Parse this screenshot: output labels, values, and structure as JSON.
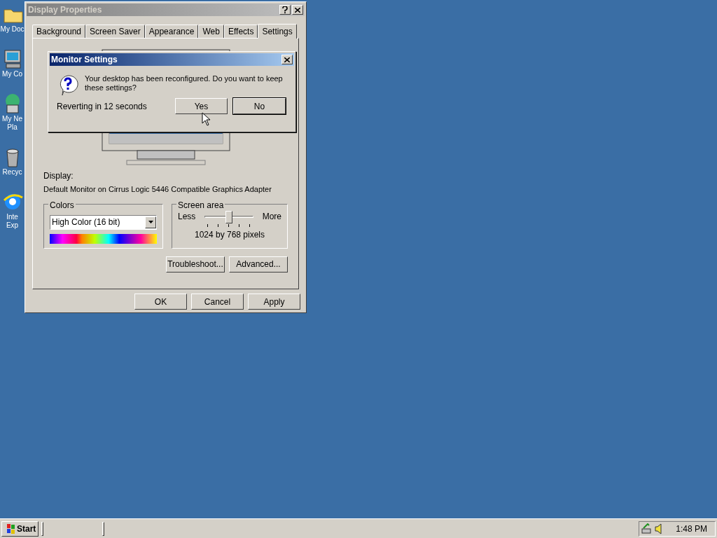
{
  "desktop_icons": [
    {
      "kind": "folder",
      "lines": [
        "My Doc"
      ]
    },
    {
      "kind": "computer",
      "lines": [
        "My Co"
      ]
    },
    {
      "kind": "network",
      "lines": [
        "My Ne",
        "Pla"
      ]
    },
    {
      "kind": "bin",
      "lines": [
        "Recyc"
      ]
    },
    {
      "kind": "browser",
      "lines": [
        "Inte",
        "Exp"
      ]
    }
  ],
  "window": {
    "title": "Display Properties",
    "active": false,
    "tabs": [
      {
        "label": "Background",
        "selected": false
      },
      {
        "label": "Screen Saver",
        "selected": false
      },
      {
        "label": "Appearance",
        "selected": false
      },
      {
        "label": "Web",
        "selected": false
      },
      {
        "label": "Effects",
        "selected": false
      },
      {
        "label": "Settings",
        "selected": true
      }
    ],
    "display_label": "Display:",
    "display_value": "Default Monitor on Cirrus Logic 5446 Compatible Graphics Adapter",
    "colors": {
      "title": "Colors",
      "value": "High Color (16 bit)"
    },
    "screen_area": {
      "title": "Screen area",
      "min_label": "Less",
      "max_label": "More",
      "level": 0.5,
      "reading": "1024 by 768 pixels"
    },
    "panel_buttons": [
      "Troubleshoot...",
      "Advanced..."
    ],
    "buttons": [
      "OK",
      "Cancel",
      "Apply"
    ]
  },
  "dialog": {
    "title": "Monitor Settings",
    "active": true,
    "message": "Your desktop has been reconfigured.  Do you want to keep these settings?",
    "countdown": "Reverting in 12 seconds",
    "buttons": [
      {
        "label": "Yes",
        "selected": false
      },
      {
        "label": "No",
        "selected": true
      }
    ]
  },
  "taskbar": {
    "start": "Start",
    "clock": "1:48 PM"
  }
}
